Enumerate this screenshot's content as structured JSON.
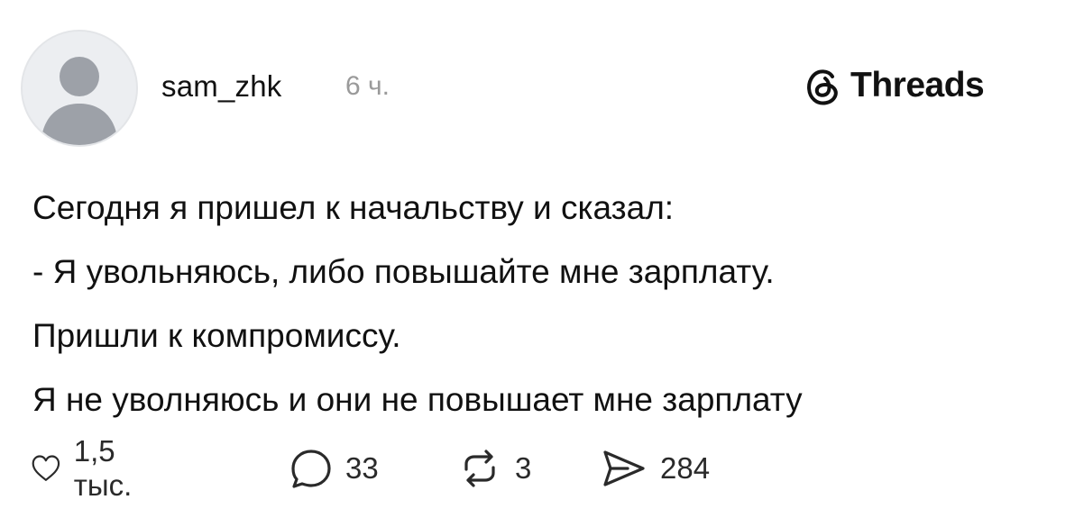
{
  "post": {
    "author": "sam_zhk",
    "time": "6 ч.",
    "brand": "Threads",
    "lines": [
      "Сегодня я пришел к начальству и сказал:",
      "- Я увольняюсь, либо повышайте мне зарплату.",
      "Пришли к компромиссу.",
      "Я не уволняюсь и они не повышает мне зарплату"
    ]
  },
  "actions": {
    "likes": "1,5 тыс.",
    "comments": "33",
    "reposts": "3",
    "shares": "284"
  },
  "icons": {
    "avatar": "default-avatar-icon",
    "brand": "threads-logo-icon",
    "like": "heart-icon",
    "comment": "speech-bubble-icon",
    "repost": "repost-arrows-icon",
    "share": "send-icon"
  },
  "colors": {
    "text": "#111111",
    "muted": "#9a9a9a",
    "avatar_bg": "#eceef1",
    "avatar_figure": "#9da1a8"
  }
}
